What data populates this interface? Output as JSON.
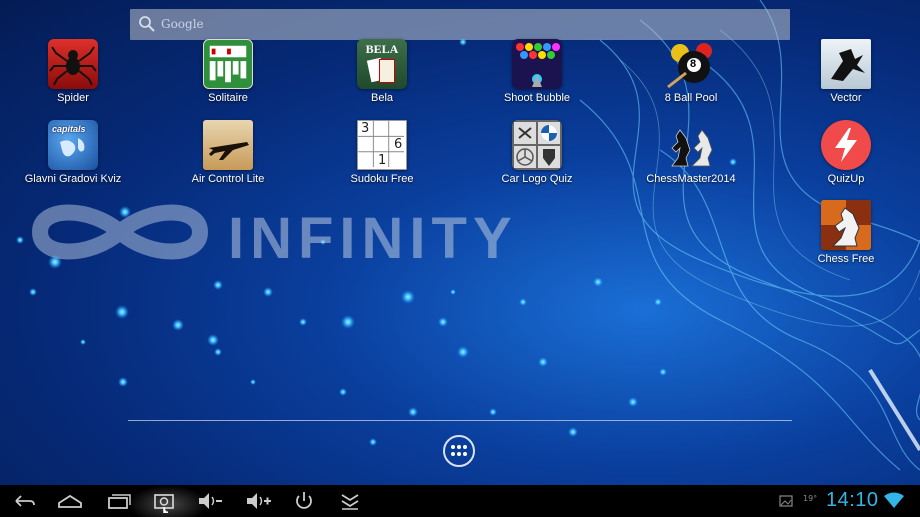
{
  "search": {
    "placeholder": "Google"
  },
  "wallpaper": {
    "brand_text": "INFINITY",
    "accent": "#1a6fd6"
  },
  "apps": [
    {
      "label": "Spider",
      "icon": "spider-icon"
    },
    {
      "label": "Solitaire",
      "icon": "solitaire-icon"
    },
    {
      "label": "Bela",
      "icon": "bela-icon",
      "icon_text": "BELA"
    },
    {
      "label": "Shoot Bubble",
      "icon": "shoot-bubble-icon"
    },
    {
      "label": "8 Ball Pool",
      "icon": "eight-ball-icon",
      "icon_text": "8"
    },
    {
      "label": "Vector",
      "icon": "vector-icon"
    },
    {
      "label": "Glavni Gradovi Kviz",
      "icon": "globe-icon",
      "icon_text": "capitals"
    },
    {
      "label": "Air Control Lite",
      "icon": "airplane-icon"
    },
    {
      "label": "Sudoku Free",
      "icon": "sudoku-icon",
      "icon_digits": [
        "3",
        "6",
        "1"
      ]
    },
    {
      "label": "Car Logo Quiz",
      "icon": "car-logo-icon"
    },
    {
      "label": "ChessMaster2014",
      "icon": "chess-knights-icon"
    },
    {
      "label": "QuizUp",
      "icon": "quizup-icon"
    },
    {
      "label": "Chess Free",
      "icon": "chess-free-icon"
    }
  ],
  "status": {
    "time": "14:10",
    "temperature": "19°"
  },
  "navbar": {
    "buttons": [
      "back-icon",
      "home-icon",
      "recent-apps-icon",
      "screenshot-icon",
      "volume-down-icon",
      "volume-up-icon",
      "power-icon",
      "menu-collapse-icon"
    ]
  }
}
